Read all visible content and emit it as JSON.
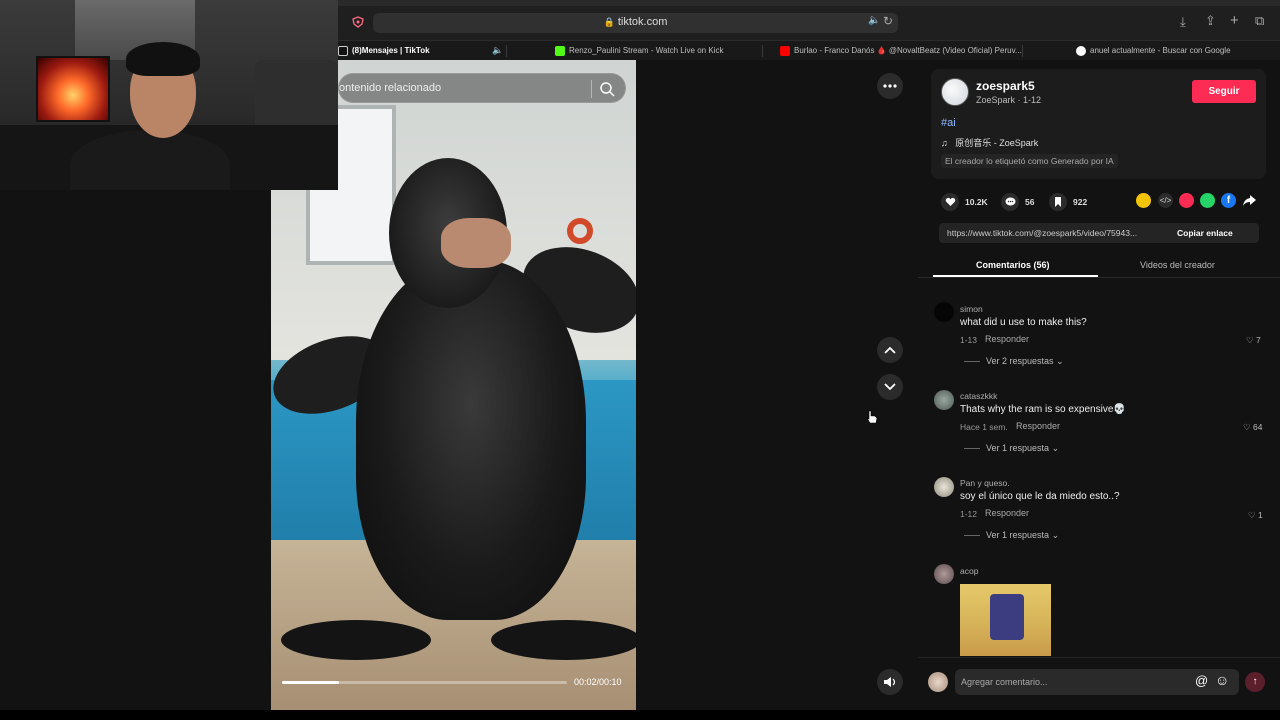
{
  "browser": {
    "url": "tiktok.com",
    "tabs": [
      {
        "label": "(8)Mensajes | TikTok",
        "active": true
      },
      {
        "label": "Renzo_Paulini Stream - Watch Live on Kick"
      },
      {
        "label": "Burlao - Franco Danós 🩸 @NovaltBeatz (Video Oficial) Peruv..."
      },
      {
        "label": "anuel actualmente - Buscar con Google"
      }
    ]
  },
  "video": {
    "search_text": "ontenido relacionado",
    "time": "00:02/00:10",
    "progress": 0.2
  },
  "creator": {
    "username": "zoespark5",
    "display_sub": "ZoeSpark · 1-12",
    "follow_label": "Seguir",
    "hashtag": "#ai",
    "music": "原创音乐 - ZoeSpark",
    "music_icon": "♫",
    "ai_label": "El creador lo etiquetó como Generado por IA"
  },
  "stats": {
    "likes": "10.2K",
    "comments": "56",
    "saves": "922"
  },
  "link": {
    "url": "https://www.tiktok.com/@zoespark5/video/75943...",
    "copy_label": "Copiar enlace"
  },
  "tabs": {
    "comments": "Comentarios (56)",
    "creator_videos": "Videos del creador"
  },
  "comments": [
    {
      "user": "simon",
      "text": "what did u use to make this?",
      "date": "1-13",
      "reply": "Responder",
      "likes": "7",
      "more": "Ver 2 respuestas"
    },
    {
      "user": "cataszkkk",
      "text": "Thats why the ram is so expensive💀",
      "date": "Hace 1 sem.",
      "reply": "Responder",
      "likes": "64",
      "more": "Ver 1 respuesta"
    },
    {
      "user": "Pan y queso.",
      "text": "soy el único que le da miedo esto..?",
      "date": "1-12",
      "reply": "Responder",
      "likes": "1",
      "more": "Ver 1 respuesta"
    },
    {
      "user": "acop"
    }
  ],
  "comment_input": {
    "placeholder": "Agregar comentario..."
  }
}
